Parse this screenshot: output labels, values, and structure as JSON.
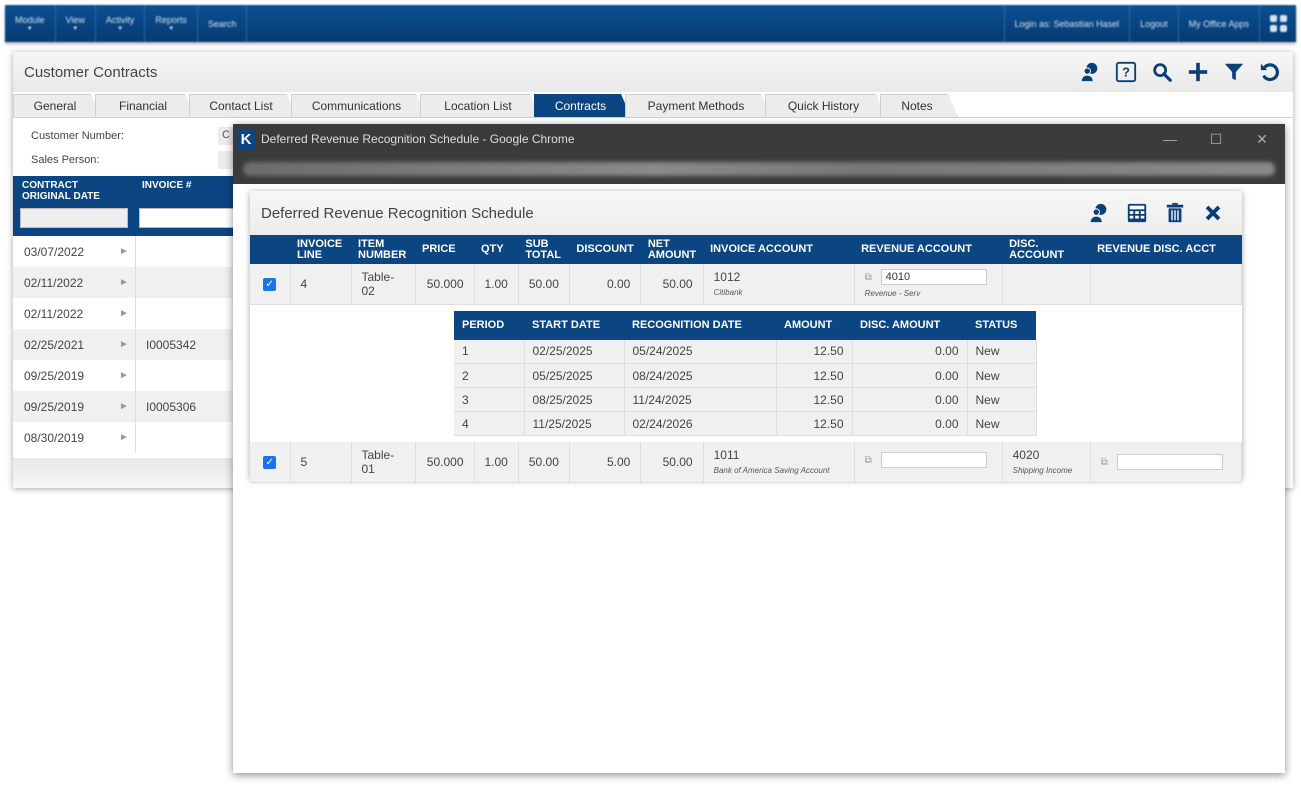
{
  "topnav": {
    "items": [
      {
        "label": "Module",
        "has_caret": true
      },
      {
        "label": "View",
        "has_caret": true
      },
      {
        "label": "Activity",
        "has_caret": true
      },
      {
        "label": "Reports",
        "has_caret": true
      },
      {
        "label": "Search",
        "has_caret": false
      }
    ],
    "login_text": "Login as: Sebastian Hasel",
    "logout_label": "Logout",
    "office_apps_label": "My Office Apps",
    "apps_icon": "grid-icon"
  },
  "panel": {
    "title": "Customer Contracts",
    "toolbar_icons": [
      "support-agent-icon",
      "help-icon",
      "search-icon",
      "add-icon",
      "filter-icon",
      "refresh-icon"
    ],
    "tabs": [
      {
        "label": "General",
        "active": false
      },
      {
        "label": "Financial",
        "active": false
      },
      {
        "label": "Contact List",
        "active": false
      },
      {
        "label": "Communications",
        "active": false
      },
      {
        "label": "Location List",
        "active": false
      },
      {
        "label": "Contracts",
        "active": true
      },
      {
        "label": "Payment Methods",
        "active": false
      },
      {
        "label": "Quick History",
        "active": false
      },
      {
        "label": "Notes",
        "active": false
      }
    ],
    "fields": {
      "customer_number_label": "Customer Number:",
      "customer_number_value": "C",
      "sales_person_label": "Sales Person:"
    },
    "contracts_list": {
      "columns": [
        "CONTRACT ORIGINAL DATE",
        "INVOICE #"
      ],
      "rows": [
        {
          "date": "03/07/2022",
          "invoice": ""
        },
        {
          "date": "02/11/2022",
          "invoice": ""
        },
        {
          "date": "02/11/2022",
          "invoice": ""
        },
        {
          "date": "02/25/2021",
          "invoice": "I0005342"
        },
        {
          "date": "09/25/2019",
          "invoice": ""
        },
        {
          "date": "09/25/2019",
          "invoice": "I0005306"
        },
        {
          "date": "08/30/2019",
          "invoice": ""
        }
      ]
    }
  },
  "chrome_window": {
    "title": "Deferred Revenue Recognition Schedule - Google Chrome",
    "logo_letter": "K",
    "url_obscured": "Not secure | demoserver/kcrm/...DeferredRevenue...",
    "controls": {
      "minimize": "—",
      "maximize": "☐",
      "close": "✕"
    }
  },
  "dialog": {
    "title": "Deferred Revenue Recognition Schedule",
    "icons": [
      "support-agent-icon",
      "calculator-icon",
      "trash-icon",
      "close-icon"
    ],
    "columns": [
      "",
      "INVOICE LINE",
      "ITEM NUMBER",
      "PRICE",
      "QTY",
      "SUB TOTAL",
      "DISCOUNT",
      "NET AMOUNT",
      "INVOICE ACCOUNT",
      "REVENUE ACCOUNT",
      "DISC. ACCOUNT",
      "REVENUE DISC. ACCT"
    ],
    "lines": [
      {
        "checked": true,
        "invoice_line": "4",
        "item_number": "Table-02",
        "price": "50.000",
        "qty": "1.00",
        "sub_total": "50.00",
        "discount": "0.00",
        "net_amount": "50.00",
        "invoice_account_code": "1012",
        "invoice_account_name": "Citibank",
        "revenue_account_value": "4010",
        "revenue_account_name": "Revenue - Serv",
        "disc_account_code": "",
        "disc_account_name": "",
        "revenue_disc_acct_value": ""
      },
      {
        "checked": true,
        "invoice_line": "5",
        "item_number": "Table-01",
        "price": "50.000",
        "qty": "1.00",
        "sub_total": "50.00",
        "discount": "5.00",
        "net_amount": "50.00",
        "invoice_account_code": "1011",
        "invoice_account_name": "Bank of America Saving Account",
        "revenue_account_value": "",
        "revenue_account_name": "",
        "disc_account_code": "4020",
        "disc_account_name": "Shipping Income",
        "revenue_disc_acct_value": ""
      }
    ],
    "schedule": {
      "columns": [
        "PERIOD",
        "START DATE",
        "RECOGNITION DATE",
        "AMOUNT",
        "DISC. AMOUNT",
        "STATUS"
      ],
      "rows": [
        {
          "period": "1",
          "start_date": "02/25/2025",
          "recognition_date": "05/24/2025",
          "amount": "12.50",
          "disc_amount": "0.00",
          "status": "New"
        },
        {
          "period": "2",
          "start_date": "05/25/2025",
          "recognition_date": "08/24/2025",
          "amount": "12.50",
          "disc_amount": "0.00",
          "status": "New"
        },
        {
          "period": "3",
          "start_date": "08/25/2025",
          "recognition_date": "11/24/2025",
          "amount": "12.50",
          "disc_amount": "0.00",
          "status": "New"
        },
        {
          "period": "4",
          "start_date": "11/25/2025",
          "recognition_date": "02/24/2026",
          "amount": "12.50",
          "disc_amount": "0.00",
          "status": "New"
        }
      ]
    }
  },
  "colors": {
    "brand_blue": "#0b4582",
    "checkbox_blue": "#1a73e8",
    "chrome_titlebar": "#3b3b3b"
  }
}
